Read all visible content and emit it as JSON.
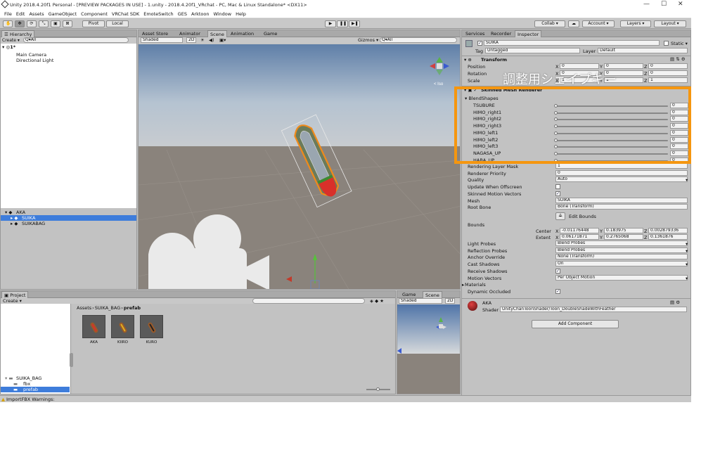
{
  "window": {
    "title": "Unity 2018.4.20f1 Personal - [PREVIEW PACKAGES IN USE] - 1.unity - 2018.4.20f1_VRchat - PC, Mac & Linux Standalone* <DX11>"
  },
  "menu": [
    "File",
    "Edit",
    "Assets",
    "GameObject",
    "Component",
    "VRChat SDK",
    "EmoteSwitch",
    "GES",
    "Arktoon",
    "Window",
    "Help"
  ],
  "toolbar": {
    "pivot": "Pivot",
    "local": "Local",
    "collab": "Collab ▾",
    "account": "Account ▾",
    "layers": "Layers ▾",
    "layout": "Layout ▾"
  },
  "hierarchy": {
    "tab": "Hierarchy",
    "create": "Create ▾",
    "search": "Q▾All",
    "scene": "1*",
    "top_items": [
      "Main Camera",
      "Directional Light"
    ],
    "bottom_items": [
      {
        "label": "AKA",
        "selected": false,
        "indent": 0
      },
      {
        "label": "SUIKA",
        "selected": true,
        "indent": 1
      },
      {
        "label": "SUIKABAG",
        "selected": false,
        "indent": 1
      }
    ]
  },
  "scene_tabs": [
    "Asset Store",
    "Animator",
    "Scene",
    "Animation",
    "Game"
  ],
  "scene_bar": {
    "shaded": "Shaded",
    "mode2d": "2D",
    "gizmos": "Gizmos ▾",
    "search": "Q▾All"
  },
  "iso": "< Iso",
  "inspector": {
    "tabs": [
      "Services",
      "Recorder",
      "Inspector"
    ],
    "object_name": "SUIKA",
    "static": "Static ▾",
    "tag_label": "Tag",
    "tag": "Untagged",
    "layer_label": "Layer",
    "layer": "Default",
    "transform": {
      "title": "Transform",
      "rows": [
        {
          "label": "Position",
          "x": "0",
          "y": "0",
          "z": "0"
        },
        {
          "label": "Rotation",
          "x": "0",
          "y": "0",
          "z": "0"
        },
        {
          "label": "Scale",
          "x": "1",
          "y": "1",
          "z": "1"
        }
      ]
    },
    "smr_title": "Skinned Mesh Renderer",
    "annotation": "調整用シェイプキー",
    "blendshapes_label": "BlendShapes",
    "blendshapes": [
      {
        "name": "TSUBURE",
        "value": "0"
      },
      {
        "name": "HIMO_right1",
        "value": "0"
      },
      {
        "name": "HIMO_right2",
        "value": "0"
      },
      {
        "name": "HIMO_right3",
        "value": "0"
      },
      {
        "name": "HIMO_left1",
        "value": "0"
      },
      {
        "name": "HIMO_left2",
        "value": "0"
      },
      {
        "name": "HIMO_left3",
        "value": "0"
      },
      {
        "name": "NAGASA_UP",
        "value": "0"
      },
      {
        "name": "HABA_UP",
        "value": "0"
      }
    ],
    "props": [
      {
        "label": "Rendering Layer Mask",
        "value": "1"
      },
      {
        "label": "Renderer Priority",
        "value": "0"
      },
      {
        "label": "Quality",
        "value": "Auto",
        "kind": "select"
      },
      {
        "label": "Update When Offscreen",
        "value": "",
        "kind": "check",
        "checked": false
      },
      {
        "label": "Skinned Motion Vectors",
        "value": "",
        "kind": "check",
        "checked": true
      },
      {
        "label": "Mesh",
        "value": "SUIKA",
        "kind": "object"
      },
      {
        "label": "Root Bone",
        "value": "Bone (Transform)",
        "kind": "object"
      }
    ],
    "edit_bounds": "Edit Bounds",
    "bounds_label": "Bounds",
    "center": {
      "label": "Center",
      "x": "-0.01176448",
      "y": "0.183975",
      "z": "0.002879336"
    },
    "extent": {
      "label": "Extent",
      "x": "0.06171871",
      "y": "0.2765068",
      "z": "0.1361876"
    },
    "props2": [
      {
        "label": "Light Probes",
        "value": "Blend Probes",
        "kind": "select"
      },
      {
        "label": "Reflection Probes",
        "value": "Blend Probes",
        "kind": "select"
      },
      {
        "label": "Anchor Override",
        "value": "None (Transform)",
        "kind": "object"
      },
      {
        "label": "Cast Shadows",
        "value": "On",
        "kind": "select"
      },
      {
        "label": "Receive Shadows",
        "value": "",
        "kind": "check",
        "checked": true
      },
      {
        "label": "Motion Vectors",
        "value": "Per Object Motion",
        "kind": "select"
      },
      {
        "label": "Materials",
        "value": "",
        "kind": "fold"
      },
      {
        "label": "Dynamic Occluded",
        "value": "",
        "kind": "check",
        "checked": true
      }
    ],
    "material_name": "AKA",
    "shader_label": "Shader",
    "shader": "UnityChanToonShader/Toon_DoubleShadeWithFeather",
    "add_component": "Add Component"
  },
  "project": {
    "tab": "Project",
    "create": "Create ▾",
    "breadcrumb": [
      "Assets",
      "SUIKA_BAG",
      "prefab"
    ],
    "assets": [
      "AKA",
      "KIIRO",
      "KURO"
    ],
    "tree": [
      {
        "label": "SUIKA_BAG",
        "indent": 0
      },
      {
        "label": "fbx",
        "indent": 1
      },
      {
        "label": "prefab",
        "indent": 1,
        "selected": true
      }
    ]
  },
  "mini": {
    "tabs": [
      "Game",
      "Scene"
    ],
    "shaded": "Shaded",
    "mode2d": "2D"
  },
  "status": "ImportFBX Warnings:",
  "colors": {
    "accent": "#3e7ddb",
    "highlight": "#f5960f"
  }
}
